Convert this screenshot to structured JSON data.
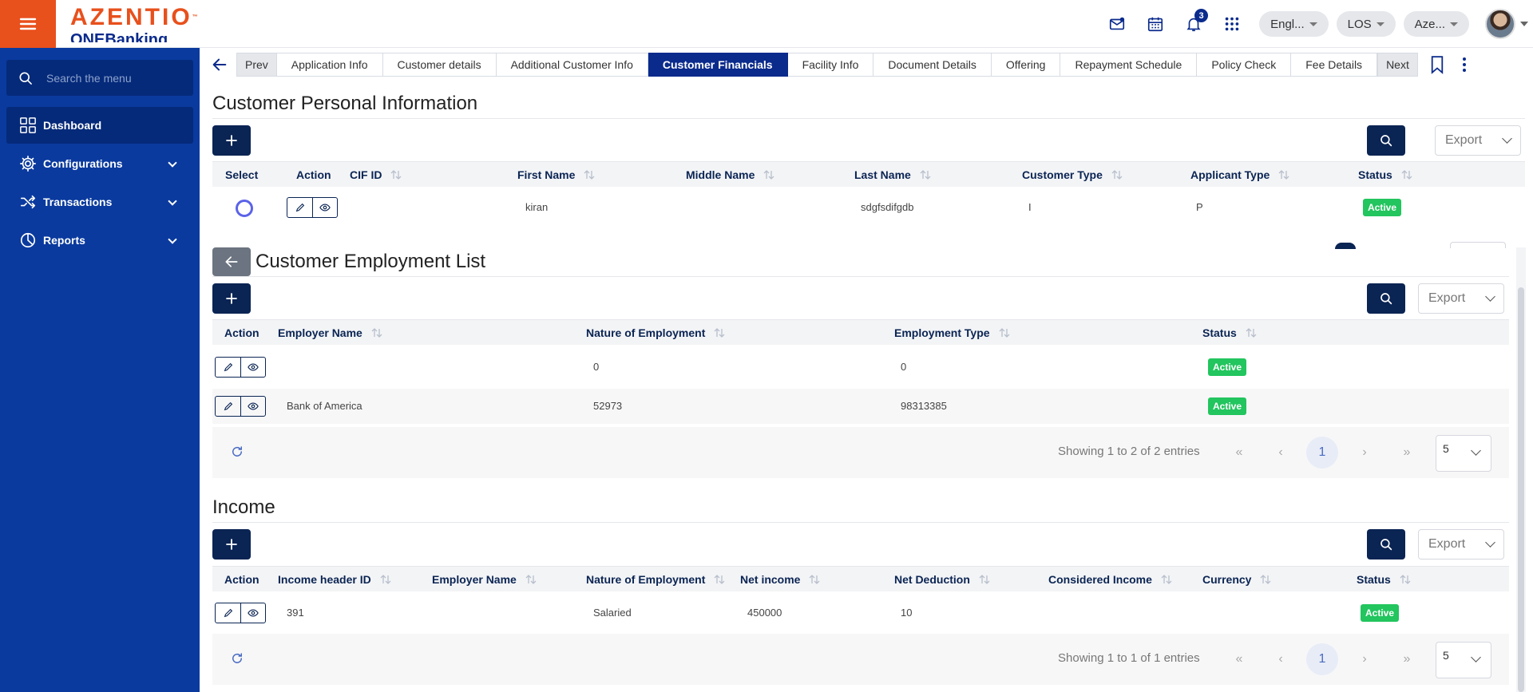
{
  "app": {
    "brand": "AZENTIO",
    "tm": "™",
    "sub_brand": "ONEBanking"
  },
  "header": {
    "notifications_count": "3",
    "language": "Engl...",
    "module": "LOS",
    "entity": "Aze..."
  },
  "sidebar": {
    "search_placeholder": "Search the menu",
    "items": [
      {
        "label": "Dashboard",
        "icon": "grid-icon"
      },
      {
        "label": "Configurations",
        "icon": "gear-icon"
      },
      {
        "label": "Transactions",
        "icon": "shuffle-icon"
      },
      {
        "label": "Reports",
        "icon": "pie-chart-icon"
      }
    ]
  },
  "tabs": {
    "prev": "Prev",
    "next": "Next",
    "items": [
      "Application Info",
      "Customer details",
      "Additional Customer Info",
      "Customer Financials",
      "Facility Info",
      "Document Details",
      "Offering",
      "Repayment Schedule",
      "Policy Check",
      "Fee Details"
    ],
    "active_index": 3
  },
  "personal": {
    "title": "Customer Personal Information",
    "export": "Export",
    "columns": [
      "Select",
      "Action",
      "CIF ID",
      "First Name",
      "Middle Name",
      "Last Name",
      "Customer Type",
      "Applicant Type",
      "Status"
    ],
    "row": {
      "cif_id": "",
      "first_name": "kiran",
      "middle_name": "",
      "last_name": "sdgfsdifgdb",
      "customer_type": "I",
      "applicant_type": "P",
      "status": "Active"
    }
  },
  "employment": {
    "title": "Customer Employment List",
    "export": "Export",
    "columns": [
      "Action",
      "Employer Name",
      "Nature of Employment",
      "Employment Type",
      "Status"
    ],
    "rows": [
      {
        "employer": "",
        "nature": "0",
        "type": "0",
        "status": "Active"
      },
      {
        "employer": "Bank of America",
        "nature": "52973",
        "type": "98313385",
        "status": "Active"
      }
    ],
    "showing": "Showing 1 to 2 of 2 entries",
    "page": "1",
    "page_size": "5"
  },
  "income": {
    "title": "Income",
    "export": "Export",
    "columns": [
      "Action",
      "Income header ID",
      "Employer Name",
      "Nature of Employment",
      "Net income",
      "Net Deduction",
      "Considered Income",
      "Currency",
      "Status"
    ],
    "rows": [
      {
        "id": "391",
        "employer": "",
        "nature": "Salaried",
        "net_income": "450000",
        "net_deduction": "10",
        "considered": "",
        "currency": "",
        "status": "Active"
      }
    ],
    "showing": "Showing 1 to 1 of 1 entries",
    "page": "1",
    "page_size": "5"
  },
  "pager_glyphs": {
    "first": "«",
    "prev": "‹",
    "next": "›",
    "last": "»"
  },
  "colors": {
    "brand_orange": "#e8501c",
    "sidebar_blue": "#0a3a9e",
    "active_tab": "#0a2a8c",
    "button_navy": "#0a2453",
    "status_green": "#22c55e"
  }
}
